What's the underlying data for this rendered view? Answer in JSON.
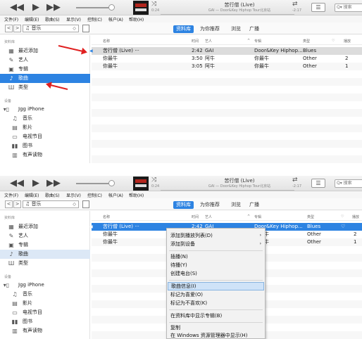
{
  "player": {
    "prev": "◀◀",
    "play": "▶",
    "next": "▶▶",
    "song_title": "苦行僧 (Live)",
    "song_sub": "GAI — Door&Key Hiphop Tour北京站",
    "elapsed": "0:24",
    "remaining": "-2:17",
    "shuffle": "⤨",
    "repeat": "⇄",
    "list_icon": "☰",
    "search_placeholder": "Q▾ 搜索"
  },
  "menubar": [
    "文件(F)",
    "编辑(E)",
    "歌曲(S)",
    "显示(V)",
    "控制(C)",
    "帐户(A)",
    "帮助(H)"
  ],
  "nav": {
    "back": "<",
    "forward": ">",
    "library": "♫ 音乐",
    "tabs": [
      "资料库",
      "为你推荐",
      "浏览",
      "广播"
    ]
  },
  "sidebar": {
    "library_header": "资料库",
    "items": [
      {
        "icon": "▦",
        "label": "最近添加"
      },
      {
        "icon": "✎",
        "label": "艺人"
      },
      {
        "icon": "▣",
        "label": "专辑"
      },
      {
        "icon": "♪",
        "label": "歌曲"
      },
      {
        "icon": "Ш",
        "label": "类型"
      }
    ],
    "devices_header": "设备",
    "device": "Jgg iPhone",
    "device_items": [
      {
        "icon": "♫",
        "label": "音乐"
      },
      {
        "icon": "▤",
        "label": "影片"
      },
      {
        "icon": "▭",
        "label": "电视节目"
      },
      {
        "icon": "▮▮",
        "label": "图书"
      },
      {
        "icon": "▥",
        "label": "有声读物"
      }
    ]
  },
  "table": {
    "headers": {
      "name": "名称",
      "time": "时间",
      "artist": "艺人",
      "album": "专辑",
      "genre": "类型",
      "heart": "♡",
      "plays": "播放"
    },
    "rows": [
      {
        "name": "苦行僧 (Live) ···",
        "time": "2:42",
        "artist": "GAI",
        "album": "Door&Key Hiphop...",
        "genre": "Blues",
        "plays": ""
      },
      {
        "name": "你最牛",
        "time": "3:50",
        "artist": "阿牛",
        "album": "你最牛",
        "genre": "Other",
        "plays": "2"
      },
      {
        "name": "你最牛",
        "time": "3:05",
        "artist": "阿牛",
        "album": "你最牛",
        "genre": "Other",
        "plays": "1"
      }
    ]
  },
  "context_menu": {
    "items": [
      "添加到播放列表(D)",
      "添加到设备",
      "插播(N)",
      "待播(Y)",
      "创建电台(S)",
      "歌曲信息(I)",
      "标记为喜爱(O)",
      "标记为不喜欢(K)",
      "在资料库中显示专辑(B)",
      "复制",
      "在 Windows 资源管理器中显示(H)"
    ],
    "submenu_arrow": "›"
  }
}
